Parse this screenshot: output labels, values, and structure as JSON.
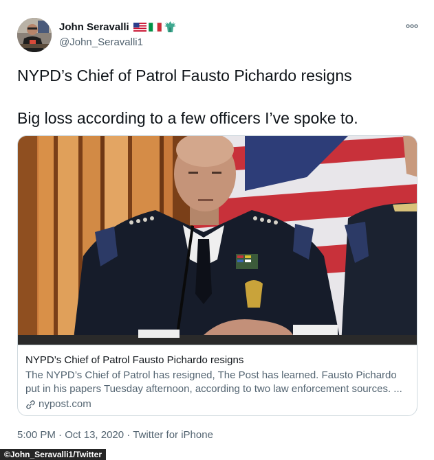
{
  "header": {
    "display_name": "John Seravalli",
    "handle": "@John_Seravalli1",
    "flag_icons": [
      "us-flag-icon",
      "italy-flag-icon",
      "statue-of-liberty-icon"
    ],
    "more_icon": "ellipsis-icon"
  },
  "tweet": {
    "line1": "NYPD’s Chief of Patrol Fausto Pichardo resigns",
    "line2": "Big loss according to a few officers I’ve spoke to."
  },
  "card": {
    "title": "NYPD’s Chief of Patrol Fausto Pichardo resigns",
    "description": "The NYPD’s Chief of Patrol has resigned, The Post has learned. Fausto Pichardo put in his papers Tuesday afternoon, according to two law enforcement sources. ...",
    "domain": "nypost.com",
    "domain_icon": "link-icon"
  },
  "meta": {
    "time": "5:00 PM",
    "separator": " · ",
    "date": "Oct 13, 2020",
    "source": "Twitter for iPhone"
  },
  "watermark": "©John_Seravalli1/Twitter",
  "colors": {
    "text_primary": "#0f1419",
    "text_secondary": "#536471",
    "card_border": "#cfd9de"
  }
}
